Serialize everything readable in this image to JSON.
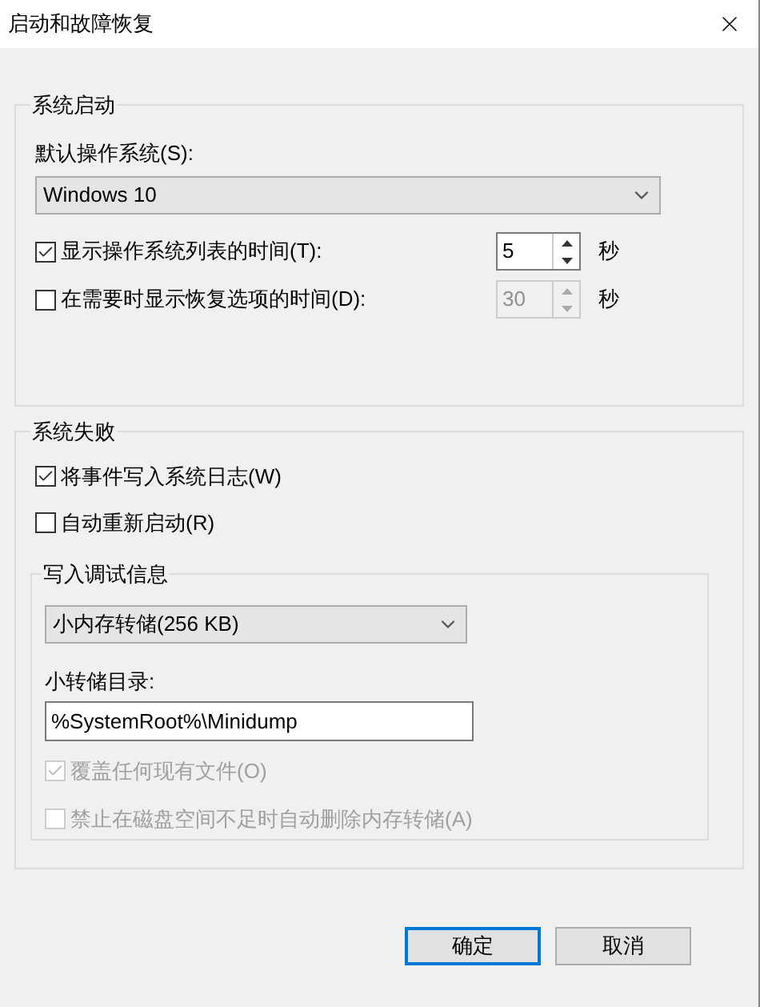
{
  "window": {
    "title": "启动和故障恢复"
  },
  "startup": {
    "legend": "系统启动",
    "default_os_label": "默认操作系统(S):",
    "default_os": "Windows 10",
    "rows": [
      {
        "label": "显示操作系统列表的时间(T):",
        "checked": true,
        "value": "5",
        "disabled": false,
        "unit": "秒"
      },
      {
        "label": "在需要时显示恢复选项的时间(D):",
        "checked": false,
        "value": "30",
        "disabled": true,
        "unit": "秒"
      }
    ]
  },
  "failure": {
    "legend": "系统失败",
    "checkboxes": [
      {
        "label": "将事件写入系统日志(W)",
        "checked": true,
        "disabled": false
      },
      {
        "label": "自动重新启动(R)",
        "checked": false,
        "disabled": false
      }
    ],
    "debug": {
      "legend": "写入调试信息",
      "dump_type": "小内存转储(256 KB)",
      "dir_label": "小转储目录:",
      "dir_value": "%SystemRoot%\\Minidump",
      "checkboxes": [
        {
          "label": "覆盖任何现有文件(O)",
          "checked": true,
          "disabled": true
        },
        {
          "label": "禁止在磁盘空间不足时自动删除内存转储(A)",
          "checked": false,
          "disabled": true
        }
      ]
    }
  },
  "buttons": [
    {
      "label": "确定",
      "default": true
    },
    {
      "label": "取消",
      "default": false
    }
  ]
}
